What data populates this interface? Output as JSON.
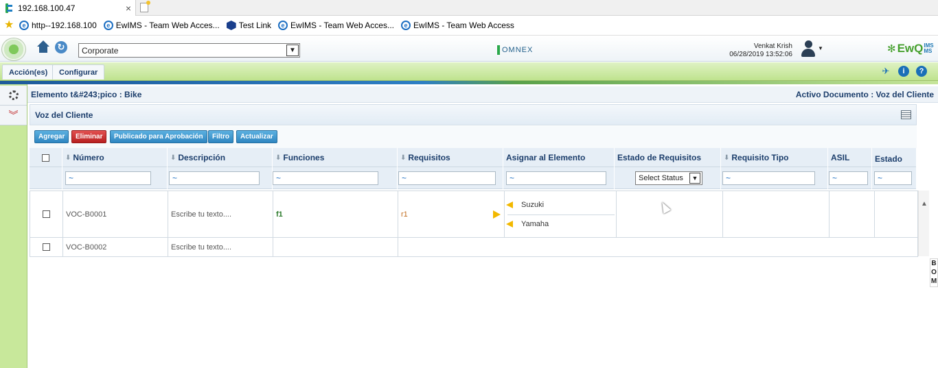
{
  "browser": {
    "tab_title": "192.168.100.47",
    "tab_close": "×",
    "favorites": [
      {
        "icon": "ie-icon",
        "label": "http--192.168.100"
      },
      {
        "icon": "ie-icon",
        "label": "EwIMS - Team Web Acces..."
      },
      {
        "icon": "testlink-icon",
        "label": "Test Link"
      },
      {
        "icon": "ie-icon",
        "label": "EwIMS - Team Web Acces..."
      },
      {
        "icon": "ie-icon",
        "label": "EwIMS - Team Web Access"
      }
    ]
  },
  "header": {
    "site_select": "Corporate",
    "omnex_logo": "OMNEX",
    "user_name": "Venkat Krish",
    "datetime": "06/28/2019 13:52:06",
    "brand": "Ew",
    "brand_q": "Q",
    "brand_sup_top": "IMS",
    "brand_sup_bottom": "MS"
  },
  "menu": {
    "items": [
      {
        "label": "Acción(es)"
      },
      {
        "label": "Configurar"
      }
    ]
  },
  "crumb": {
    "left": "Elemento t&#243;pico : Bike",
    "right": "Activo Documento : Voz del Cliente"
  },
  "panel": {
    "title": "Voz del Cliente"
  },
  "actions": {
    "add": "Agregar",
    "delete": "Eliminar",
    "publish": "Publicado para Aprobación",
    "filter": "Filtro",
    "refresh": "Actualizar"
  },
  "table": {
    "columns": [
      "Número",
      "Descripción",
      "Funciones",
      "Requisitos",
      "Asignar al Elemento",
      "Estado de Requisitos",
      "Requisito Tipo",
      "ASIL",
      "Estado"
    ],
    "filter_value": "~",
    "status_select": "Select Status",
    "rows": [
      {
        "numero": "VOC-B0001",
        "descripcion": "Escribe tu texto....",
        "funciones": "f1",
        "requisitos": "r1",
        "asignar": [
          "Suzuki",
          "Yamaha"
        ]
      },
      {
        "numero": "VOC-B0002",
        "descripcion": "Escribe tu texto....",
        "funciones": "",
        "requisitos": "",
        "asignar": []
      }
    ]
  },
  "side_tab": [
    "B",
    "O",
    "M"
  ],
  "colors": {
    "menu_green": "#bfe38e",
    "header_blue": "#1b3d6b",
    "delete_red": "#c0282a",
    "action_blue": "#2f86c1"
  }
}
